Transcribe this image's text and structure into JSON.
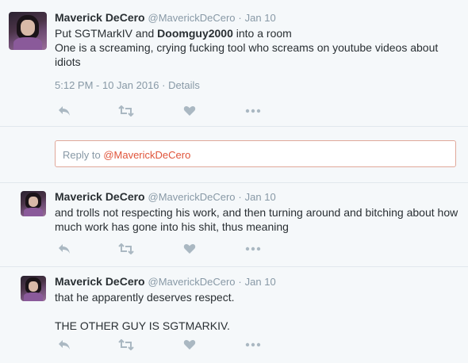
{
  "main_tweet": {
    "name": "Maverick DeCero",
    "handle": "@MaverickDeCero",
    "separator": "·",
    "date": "Jan 10",
    "text_part1": "Put SGTMarkIV and ",
    "text_bold": "Doomguy2000",
    "text_part2": " into a room",
    "text_line2": "One is a screaming, crying fucking tool who screams on youtube videos about idiots",
    "timestamp": "5:12 PM - 10 Jan 2016",
    "details_sep": "·",
    "details": "Details"
  },
  "reply_box": {
    "prefix": "Reply to ",
    "mention": "@MaverickDeCero"
  },
  "reply_1": {
    "name": "Maverick DeCero",
    "handle": "@MaverickDeCero",
    "separator": "·",
    "date": "Jan 10",
    "text": "and trolls not respecting his work, and then turning around and bitching about how much work has gone into his shit, thus meaning"
  },
  "reply_2": {
    "name": "Maverick DeCero",
    "handle": "@MaverickDeCero",
    "separator": "·",
    "date": "Jan 10",
    "text_line1": "that he apparently deserves respect.",
    "text_line2": "THE OTHER GUY IS SGTMARKIV."
  },
  "icons": {
    "reply": "reply-icon",
    "retweet": "retweet-icon",
    "like": "heart-icon",
    "more": "more-icon"
  },
  "colors": {
    "background": "#f5f8fa",
    "icon": "#aab8c2",
    "secondary_text": "#8899a6",
    "mention": "#e0543a"
  }
}
